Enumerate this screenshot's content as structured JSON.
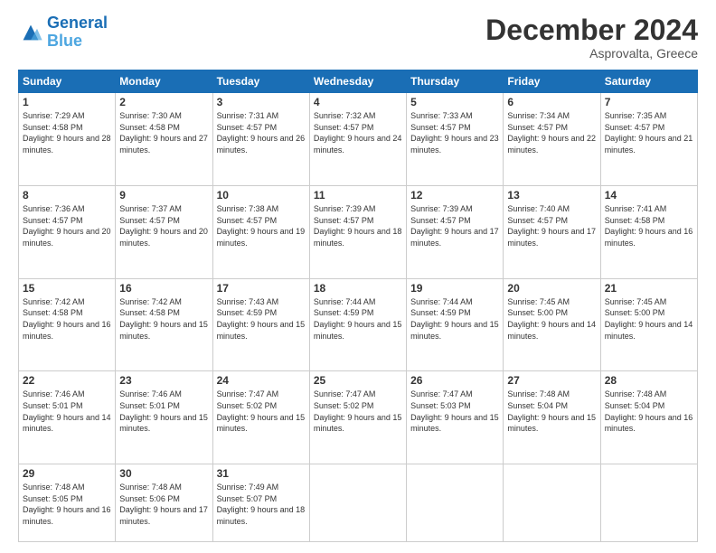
{
  "header": {
    "logo_line1": "General",
    "logo_line2": "Blue",
    "month": "December 2024",
    "location": "Asprovalta, Greece"
  },
  "weekdays": [
    "Sunday",
    "Monday",
    "Tuesday",
    "Wednesday",
    "Thursday",
    "Friday",
    "Saturday"
  ],
  "weeks": [
    [
      {
        "day": "1",
        "sunrise": "7:29 AM",
        "sunset": "4:58 PM",
        "daylight": "9 hours and 28 minutes."
      },
      {
        "day": "2",
        "sunrise": "7:30 AM",
        "sunset": "4:58 PM",
        "daylight": "9 hours and 27 minutes."
      },
      {
        "day": "3",
        "sunrise": "7:31 AM",
        "sunset": "4:57 PM",
        "daylight": "9 hours and 26 minutes."
      },
      {
        "day": "4",
        "sunrise": "7:32 AM",
        "sunset": "4:57 PM",
        "daylight": "9 hours and 24 minutes."
      },
      {
        "day": "5",
        "sunrise": "7:33 AM",
        "sunset": "4:57 PM",
        "daylight": "9 hours and 23 minutes."
      },
      {
        "day": "6",
        "sunrise": "7:34 AM",
        "sunset": "4:57 PM",
        "daylight": "9 hours and 22 minutes."
      },
      {
        "day": "7",
        "sunrise": "7:35 AM",
        "sunset": "4:57 PM",
        "daylight": "9 hours and 21 minutes."
      }
    ],
    [
      {
        "day": "8",
        "sunrise": "7:36 AM",
        "sunset": "4:57 PM",
        "daylight": "9 hours and 20 minutes."
      },
      {
        "day": "9",
        "sunrise": "7:37 AM",
        "sunset": "4:57 PM",
        "daylight": "9 hours and 20 minutes."
      },
      {
        "day": "10",
        "sunrise": "7:38 AM",
        "sunset": "4:57 PM",
        "daylight": "9 hours and 19 minutes."
      },
      {
        "day": "11",
        "sunrise": "7:39 AM",
        "sunset": "4:57 PM",
        "daylight": "9 hours and 18 minutes."
      },
      {
        "day": "12",
        "sunrise": "7:39 AM",
        "sunset": "4:57 PM",
        "daylight": "9 hours and 17 minutes."
      },
      {
        "day": "13",
        "sunrise": "7:40 AM",
        "sunset": "4:57 PM",
        "daylight": "9 hours and 17 minutes."
      },
      {
        "day": "14",
        "sunrise": "7:41 AM",
        "sunset": "4:58 PM",
        "daylight": "9 hours and 16 minutes."
      }
    ],
    [
      {
        "day": "15",
        "sunrise": "7:42 AM",
        "sunset": "4:58 PM",
        "daylight": "9 hours and 16 minutes."
      },
      {
        "day": "16",
        "sunrise": "7:42 AM",
        "sunset": "4:58 PM",
        "daylight": "9 hours and 15 minutes."
      },
      {
        "day": "17",
        "sunrise": "7:43 AM",
        "sunset": "4:59 PM",
        "daylight": "9 hours and 15 minutes."
      },
      {
        "day": "18",
        "sunrise": "7:44 AM",
        "sunset": "4:59 PM",
        "daylight": "9 hours and 15 minutes."
      },
      {
        "day": "19",
        "sunrise": "7:44 AM",
        "sunset": "4:59 PM",
        "daylight": "9 hours and 15 minutes."
      },
      {
        "day": "20",
        "sunrise": "7:45 AM",
        "sunset": "5:00 PM",
        "daylight": "9 hours and 14 minutes."
      },
      {
        "day": "21",
        "sunrise": "7:45 AM",
        "sunset": "5:00 PM",
        "daylight": "9 hours and 14 minutes."
      }
    ],
    [
      {
        "day": "22",
        "sunrise": "7:46 AM",
        "sunset": "5:01 PM",
        "daylight": "9 hours and 14 minutes."
      },
      {
        "day": "23",
        "sunrise": "7:46 AM",
        "sunset": "5:01 PM",
        "daylight": "9 hours and 15 minutes."
      },
      {
        "day": "24",
        "sunrise": "7:47 AM",
        "sunset": "5:02 PM",
        "daylight": "9 hours and 15 minutes."
      },
      {
        "day": "25",
        "sunrise": "7:47 AM",
        "sunset": "5:02 PM",
        "daylight": "9 hours and 15 minutes."
      },
      {
        "day": "26",
        "sunrise": "7:47 AM",
        "sunset": "5:03 PM",
        "daylight": "9 hours and 15 minutes."
      },
      {
        "day": "27",
        "sunrise": "7:48 AM",
        "sunset": "5:04 PM",
        "daylight": "9 hours and 15 minutes."
      },
      {
        "day": "28",
        "sunrise": "7:48 AM",
        "sunset": "5:04 PM",
        "daylight": "9 hours and 16 minutes."
      }
    ],
    [
      {
        "day": "29",
        "sunrise": "7:48 AM",
        "sunset": "5:05 PM",
        "daylight": "9 hours and 16 minutes."
      },
      {
        "day": "30",
        "sunrise": "7:48 AM",
        "sunset": "5:06 PM",
        "daylight": "9 hours and 17 minutes."
      },
      {
        "day": "31",
        "sunrise": "7:49 AM",
        "sunset": "5:07 PM",
        "daylight": "9 hours and 18 minutes."
      },
      null,
      null,
      null,
      null
    ]
  ]
}
